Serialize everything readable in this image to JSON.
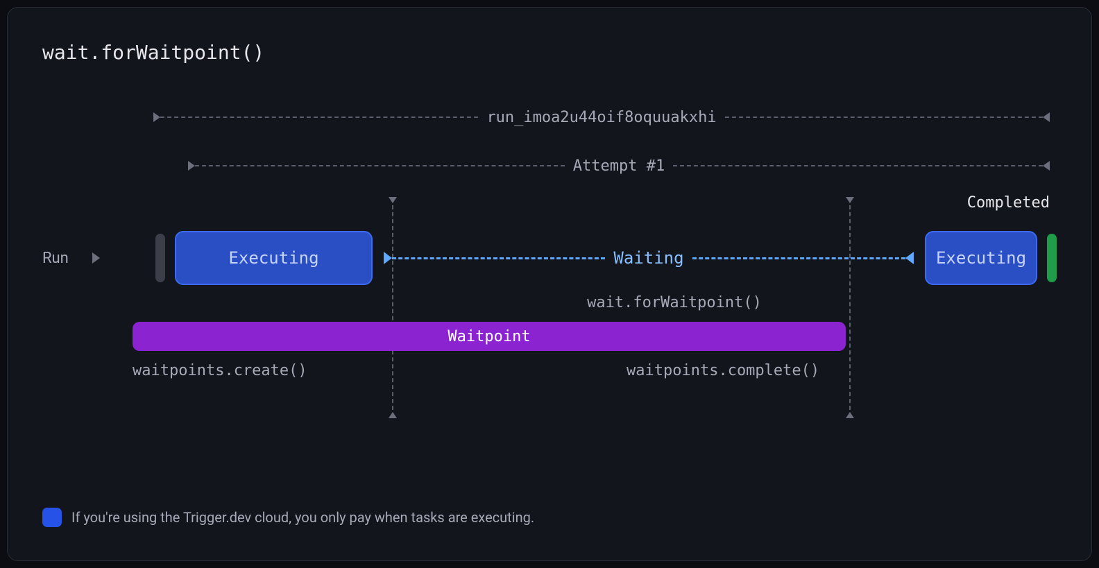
{
  "title": "wait.forWaitpoint()",
  "span_run_id": "run_imoa2u44oif8oquuakxhi",
  "span_attempt": "Attempt #1",
  "completed_label": "Completed",
  "run_label": "Run",
  "stage_executing1": "Executing",
  "stage_waiting": "Waiting",
  "stage_executing2": "Executing",
  "waitpoint_method": "wait.forWaitpoint()",
  "waitpoint_bar": "Waitpoint",
  "waitpoints_create": "waitpoints.create()",
  "waitpoints_complete": "waitpoints.complete()",
  "footer_note": "If you're using the Trigger.dev cloud, you only pay when tasks are executing."
}
